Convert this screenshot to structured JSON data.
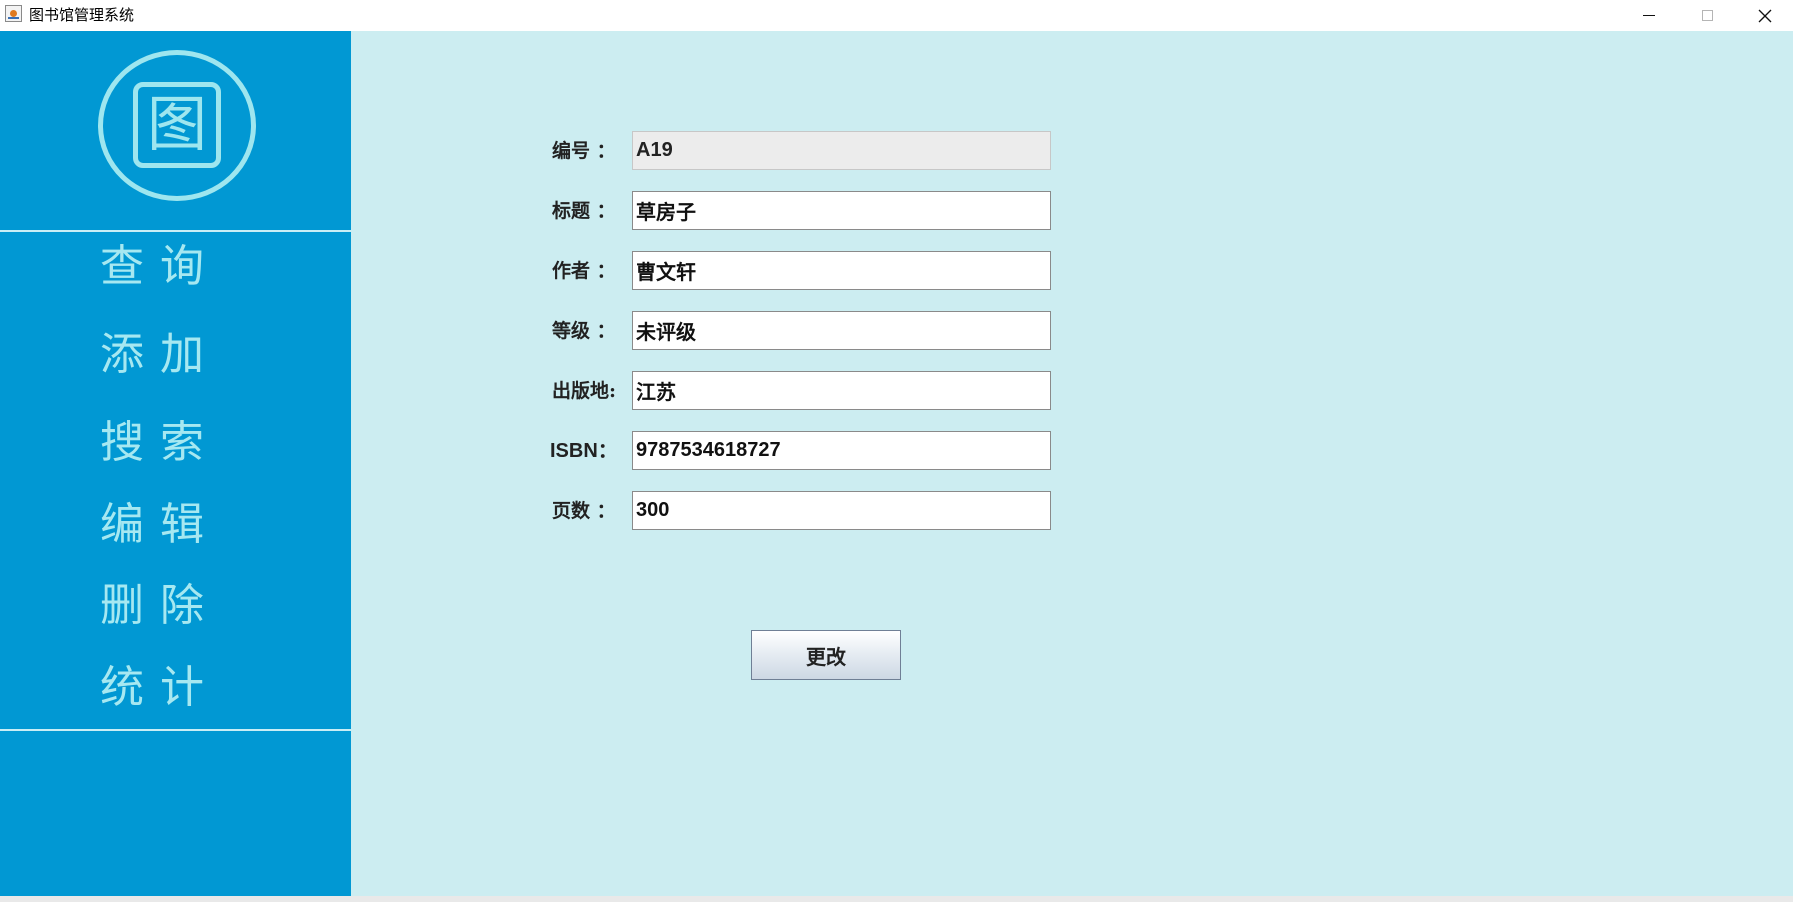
{
  "window": {
    "title": "图书馆管理系统",
    "controls": {
      "minimize": "minimize-icon",
      "maximize": "maximize-icon",
      "close": "close-icon"
    }
  },
  "sidebar": {
    "logo_glyph": "图",
    "items": [
      {
        "label": "查询"
      },
      {
        "label": "添加"
      },
      {
        "label": "搜索"
      },
      {
        "label": "编辑"
      },
      {
        "label": "删除"
      },
      {
        "label": "统计"
      }
    ]
  },
  "form": {
    "fields": [
      {
        "label": "编号 ：",
        "value": "A19"
      },
      {
        "label": "标题 ：",
        "value": "草房子"
      },
      {
        "label": "作者 ：",
        "value": "曹文轩"
      },
      {
        "label": "等级 ：",
        "value": "未评级"
      },
      {
        "label": "出版地:",
        "value": "江苏"
      },
      {
        "label": "ISBN：",
        "value": "9787534618727"
      },
      {
        "label": "页数 ：",
        "value": "300"
      }
    ],
    "submit_label": "更改"
  },
  "colors": {
    "sidebar_bg": "#0198d3",
    "sidebar_text": "#a6e8f1",
    "main_bg": "#ccedf1"
  }
}
